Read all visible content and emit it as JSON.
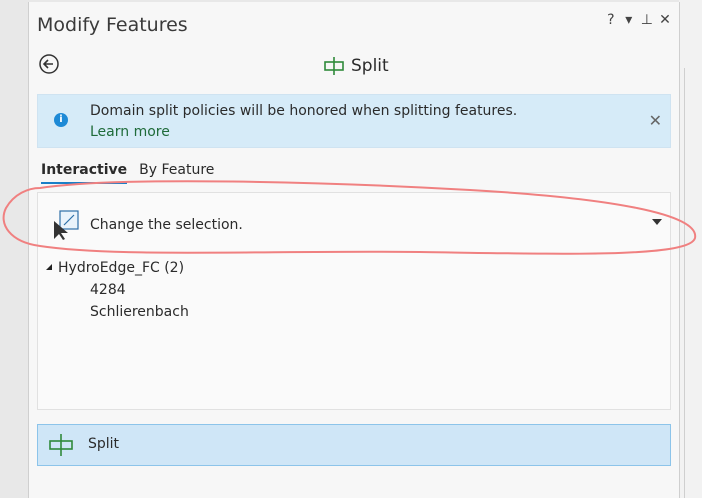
{
  "window": {
    "title": "Modify Features",
    "controls": [
      "?",
      "▾",
      "⊥",
      "✕"
    ]
  },
  "tool": {
    "title": "Split",
    "icon": "split-icon"
  },
  "banner": {
    "message": "Domain split policies will be honored when splitting features.",
    "link": "Learn more",
    "icon": "info-icon",
    "close": "✕"
  },
  "tabs": [
    {
      "label": "Interactive",
      "active": true
    },
    {
      "label": "By Feature",
      "active": false
    }
  ],
  "selection": {
    "label": "Change the selection.",
    "icon": "change-selection-icon"
  },
  "tree": {
    "root": "HydroEdge_FC (2)",
    "children": [
      "4284",
      "Schlierenbach"
    ]
  },
  "split_button": {
    "label": "Split"
  },
  "colors": {
    "accent": "#1a7fc7",
    "banner_bg": "#d6ebf8",
    "button_bg": "#cfe6f7",
    "annotation": "#f08080"
  }
}
